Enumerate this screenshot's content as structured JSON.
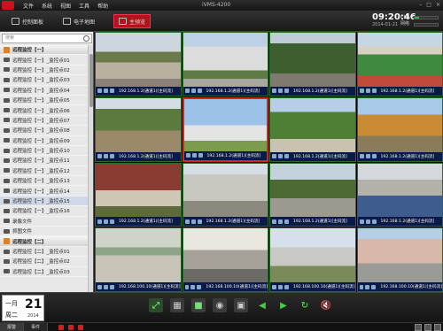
{
  "menubar": {
    "items": [
      "文件",
      "系统",
      "视图",
      "工具",
      "帮助"
    ],
    "title": "iVMS-4200"
  },
  "tabs": [
    {
      "label": "控制面板",
      "active": false
    },
    {
      "label": "电子地图",
      "active": false
    },
    {
      "label": "主预览",
      "active": true
    }
  ],
  "clock": {
    "time": "09:20:46",
    "date": "2014-01-21"
  },
  "stats": {
    "cpu_label": "CPU",
    "net_label": "网络",
    "cpu_level": 0.2
  },
  "sidebar": {
    "search_placeholder": "搜索",
    "items": [
      {
        "label": "远程监控【一】",
        "type": "group"
      },
      {
        "label": "远程监控【一】_监控点01",
        "type": "camera"
      },
      {
        "label": "远程监控【一】_监控点02",
        "type": "camera"
      },
      {
        "label": "远程监控【一】_监控点03",
        "type": "camera"
      },
      {
        "label": "远程监控【一】_监控点04",
        "type": "camera"
      },
      {
        "label": "远程监控【一】_监控点05",
        "type": "camera"
      },
      {
        "label": "远程监控【一】_监控点06",
        "type": "camera"
      },
      {
        "label": "远程监控【一】_监控点07",
        "type": "camera"
      },
      {
        "label": "远程监控【一】_监控点08",
        "type": "camera"
      },
      {
        "label": "远程监控【一】_监控点09",
        "type": "camera"
      },
      {
        "label": "远程监控【一】_监控点10",
        "type": "camera"
      },
      {
        "label": "远程监控【一】_监控点11",
        "type": "camera"
      },
      {
        "label": "远程监控【一】_监控点12",
        "type": "camera"
      },
      {
        "label": "远程监控【一】_监控点13",
        "type": "camera"
      },
      {
        "label": "远程监控【一】_监控点14",
        "type": "camera"
      },
      {
        "label": "远程监控【一】_监控点15",
        "type": "camera",
        "selected": true
      },
      {
        "label": "远程监控【一】_监控点16",
        "type": "camera"
      },
      {
        "label": "录像文件",
        "type": "folder"
      },
      {
        "label": "抓图文件",
        "type": "folder"
      },
      {
        "label": "远程监控【二】",
        "type": "group"
      },
      {
        "label": "远程监控【二】_监控点01",
        "type": "camera"
      },
      {
        "label": "远程监控【二】_监控点02",
        "type": "camera"
      },
      {
        "label": "远程监控【二】_监控点03",
        "type": "camera"
      }
    ]
  },
  "cameras": [
    {
      "label": "192.168.1.2(通道1)[主码流]",
      "scene": "street"
    },
    {
      "label": "192.168.1.2(通道1)[主码流]",
      "scene": "building"
    },
    {
      "label": "192.168.1.2(通道1)[主码流]",
      "scene": "trees"
    },
    {
      "label": "192.168.1.2(通道1)[主码流]",
      "scene": "field"
    },
    {
      "label": "192.168.1.2(通道1)[主码流]",
      "scene": "park"
    },
    {
      "label": "192.168.1.2(通道1)[主码流]",
      "scene": "tower"
    },
    {
      "label": "192.168.1.2(通道1)[主码流]",
      "scene": "garden"
    },
    {
      "label": "192.168.1.2(通道1)[主码流]",
      "scene": "autumn"
    },
    {
      "label": "192.168.1.2(通道1)[主码流]",
      "scene": "arch"
    },
    {
      "label": "192.168.1.2(通道1)[主码流]",
      "scene": "block"
    },
    {
      "label": "192.168.1.2(通道1)[主码流]",
      "scene": "avenue"
    },
    {
      "label": "192.168.1.2(通道1)[主码流]",
      "scene": "hall"
    },
    {
      "label": "192.168.100.10(通道1)[主码流]",
      "scene": "classroom"
    },
    {
      "label": "192.168.100.10(通道1)[主码流]",
      "scene": "lab"
    },
    {
      "label": "192.168.100.10(通道1)[主码流]",
      "scene": "campus"
    },
    {
      "label": "192.168.100.10(通道1)[主码流]",
      "scene": "towers"
    }
  ],
  "calendar": {
    "month": "一月",
    "weekday": "周二",
    "day": "21",
    "year": "2014"
  },
  "statusbar": {
    "tab1": "报警",
    "tab2": "事件"
  }
}
